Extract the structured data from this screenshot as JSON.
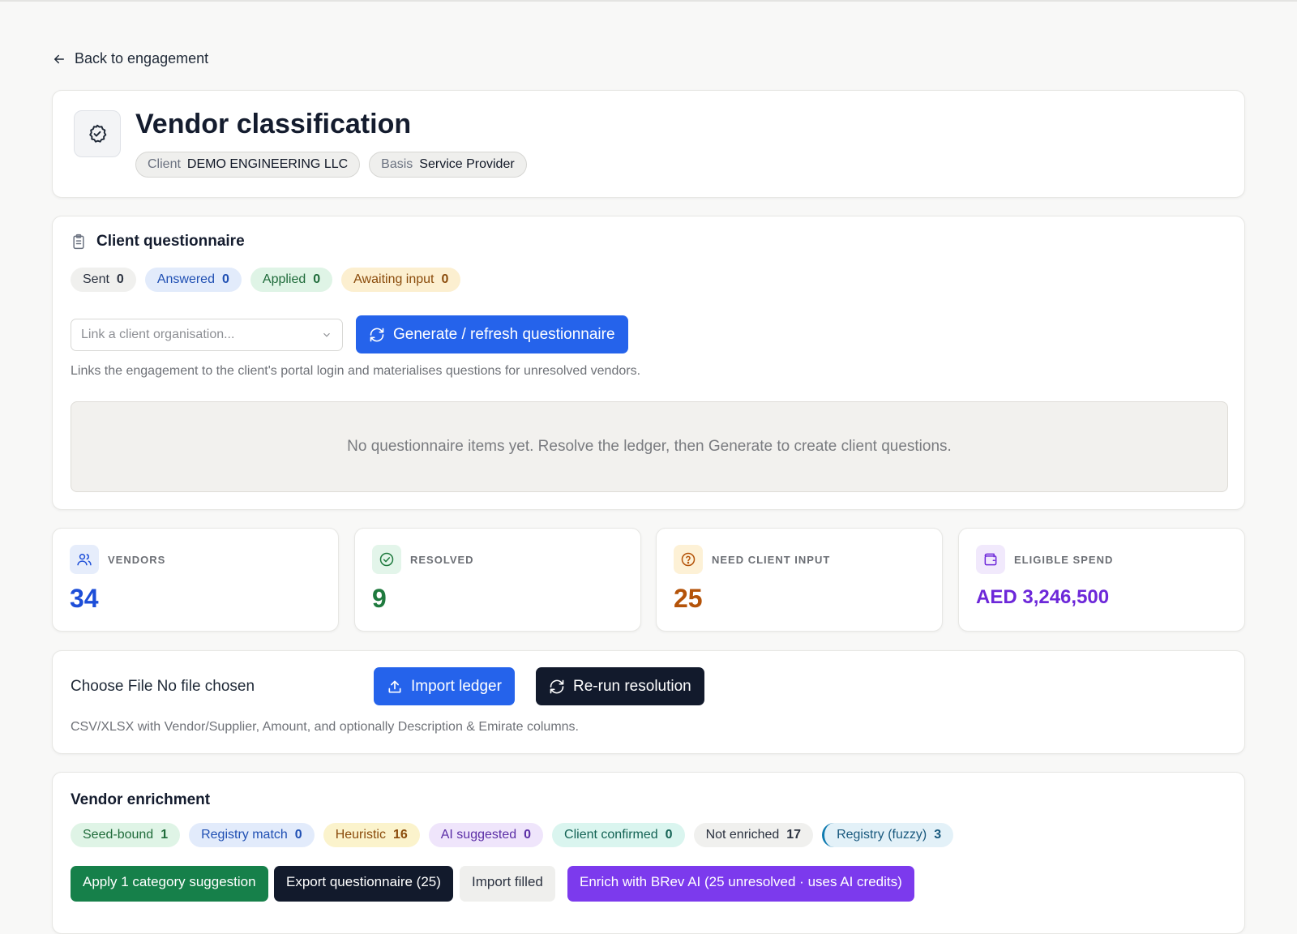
{
  "back_label": "Back to engagement",
  "header": {
    "title": "Vendor classification",
    "client_key": "Client",
    "client_value": "DEMO ENGINEERING LLC",
    "basis_key": "Basis",
    "basis_value": "Service Provider"
  },
  "questionnaire": {
    "title": "Client questionnaire",
    "chips": [
      {
        "label": "Sent",
        "count": "0"
      },
      {
        "label": "Answered",
        "count": "0"
      },
      {
        "label": "Applied",
        "count": "0"
      },
      {
        "label": "Awaiting input",
        "count": "0"
      }
    ],
    "org_placeholder": "Link a client organisation...",
    "generate_label": "Generate / refresh questionnaire",
    "hint": "Links the engagement to the client's portal login and materialises questions for unresolved vendors.",
    "empty_message": "No questionnaire items yet. Resolve the ledger, then Generate to create client questions."
  },
  "stats": [
    {
      "label": "VENDORS",
      "value": "34",
      "color": "#1d4ed8"
    },
    {
      "label": "RESOLVED",
      "value": "9",
      "color": "#1f7a3e"
    },
    {
      "label": "NEED CLIENT INPUT",
      "value": "25",
      "color": "#b45309"
    },
    {
      "label": "ELIGIBLE SPEND",
      "value": "AED 3,246,500",
      "color": "#6d28d9"
    }
  ],
  "import": {
    "file_label": "Choose File No file chosen",
    "import_label": "Import ledger",
    "rerun_label": "Re-run resolution",
    "hint": "CSV/XLSX with Vendor/Supplier, Amount, and optionally Description & Emirate columns."
  },
  "enrichment": {
    "title": "Vendor enrichment",
    "chips": [
      {
        "label": "Seed-bound",
        "count": "1"
      },
      {
        "label": "Registry match",
        "count": "0"
      },
      {
        "label": "Heuristic",
        "count": "16"
      },
      {
        "label": "AI suggested",
        "count": "0"
      },
      {
        "label": "Client confirmed",
        "count": "0"
      },
      {
        "label": "Not enriched",
        "count": "17"
      },
      {
        "label": "Registry (fuzzy)",
        "count": "3"
      }
    ],
    "actions": [
      "Apply 1 category suggestion",
      "Export questionnaire (25)",
      "Import filled",
      "Enrich with BRev AI (25 unresolved · uses AI credits)"
    ]
  }
}
